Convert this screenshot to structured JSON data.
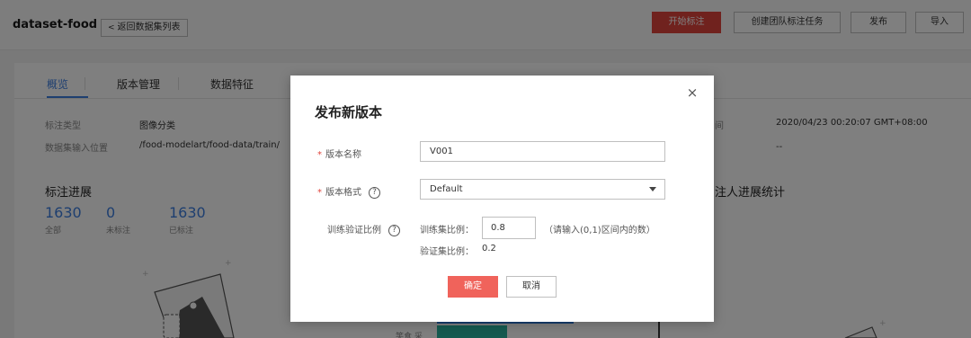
{
  "header": {
    "dataset_name": "dataset-food",
    "back_label": "返回数据集列表",
    "buttons": {
      "start_label": "开始标注",
      "team_task": "创建团队标注任务",
      "publish": "发布",
      "import": "导入"
    }
  },
  "tabs": [
    "概览",
    "版本管理",
    "数据特征"
  ],
  "info": {
    "annotation_type_label": "标注类型",
    "annotation_type_value": "图像分类",
    "input_location_label": "数据集输入位置",
    "input_location_value": "/food-modelart/food-data/train/",
    "created_label_fragment": "间",
    "created_value": "2020/04/23 00:20:07 GMT+08:00",
    "dash": "--"
  },
  "progress": {
    "title": "标注进展",
    "stats": [
      {
        "value": "1630",
        "label": "全部"
      },
      {
        "value": "0",
        "label": "未标注"
      },
      {
        "value": "1630",
        "label": "已标注"
      }
    ],
    "right_title_fragment": "注人进展统计",
    "chart_label_fragment": "笑食 采"
  },
  "dialog": {
    "title": "发布新版本",
    "version_name_label": "版本名称",
    "version_name_value": "V001",
    "format_label": "版本格式",
    "format_value": "Default",
    "split_label": "训练验证比例",
    "train_ratio_label": "训练集比例：",
    "train_ratio_value": "0.8",
    "ratio_hint": "（请输入(0,1)区间内的数）",
    "val_ratio_label": "验证集比例：",
    "val_ratio_value": "0.2",
    "ok_label": "确定",
    "cancel_label": "取消",
    "help_glyph": "?",
    "close_glyph": "×",
    "required_mark": "*"
  },
  "colors": {
    "accent_blue": "#3d7ee0",
    "primary_red": "#e0453d",
    "ok_button": "#f0635b"
  }
}
